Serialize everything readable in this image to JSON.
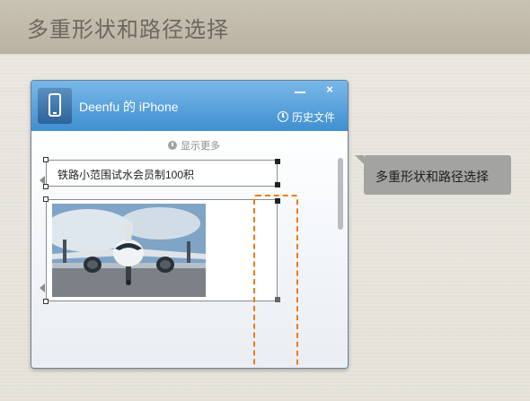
{
  "header": {
    "title": "多重形状和路径选择"
  },
  "window": {
    "contact_name": "Deenfu 的 iPhone",
    "minimize_icon": "minimize-icon",
    "close_label": "×",
    "history_label": "历史文件",
    "history_icon": "clock-icon"
  },
  "chat": {
    "show_more_label": "显示更多",
    "messages": [
      {
        "type": "text",
        "text": "铁路小范围试水会员制100积"
      },
      {
        "type": "image",
        "subject": "airplane-photo"
      }
    ]
  },
  "callout": {
    "text": "多重形状和路径选择"
  },
  "colors": {
    "titlebar": "#3f8fd0",
    "selection": "#f07a1a",
    "callout_bg": "#a3a3a1"
  }
}
